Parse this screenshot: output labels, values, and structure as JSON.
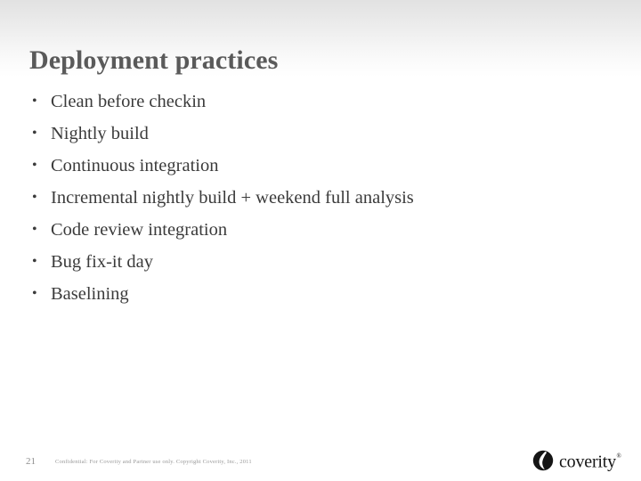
{
  "slide": {
    "title": "Deployment practices",
    "bullet_marker": "•",
    "bullets": [
      {
        "text": "Clean before checkin"
      },
      {
        "text": "Nightly build"
      },
      {
        "text": "Continuous integration"
      },
      {
        "text": "Incremental nightly build + weekend full analysis"
      },
      {
        "text": "Code review integration"
      },
      {
        "text": "Bug fix-it day"
      },
      {
        "text": "Baselining"
      }
    ]
  },
  "footer": {
    "page_number": "21",
    "confidentiality_note": "Confidential: For Coverity and Partner use only. Copyright Coverity, Inc., 2011",
    "logo_wordmark": "coverity",
    "logo_registered_mark": "®"
  },
  "colors": {
    "title": "#5a5a5a",
    "body_text": "#3b3b3b",
    "footer_text": "#9a9a9a",
    "page_number": "#8e8e8e",
    "logo": "#151515",
    "background": "#ffffff",
    "header_gradient_top": "#e2e2e2"
  }
}
